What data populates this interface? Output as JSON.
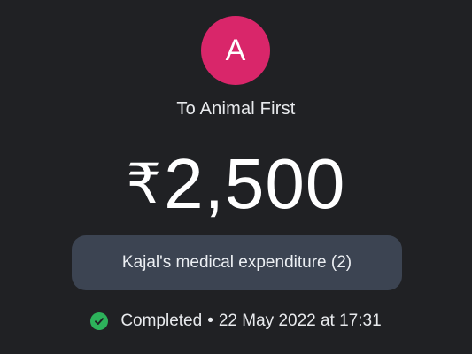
{
  "avatar": {
    "initial": "A",
    "color": "#d9266a"
  },
  "recipient": {
    "label": "To Animal First"
  },
  "payment": {
    "currency_symbol": "₹",
    "amount": "2,500"
  },
  "note": {
    "text": "Kajal's medical expenditure (2)"
  },
  "status": {
    "icon": "check-circle-icon",
    "label": "Completed",
    "separator": "•",
    "datetime": "22 May 2022 at 17:31",
    "color": "#2db25b"
  },
  "theme": {
    "background": "#202124",
    "pill": "#3c4452"
  }
}
